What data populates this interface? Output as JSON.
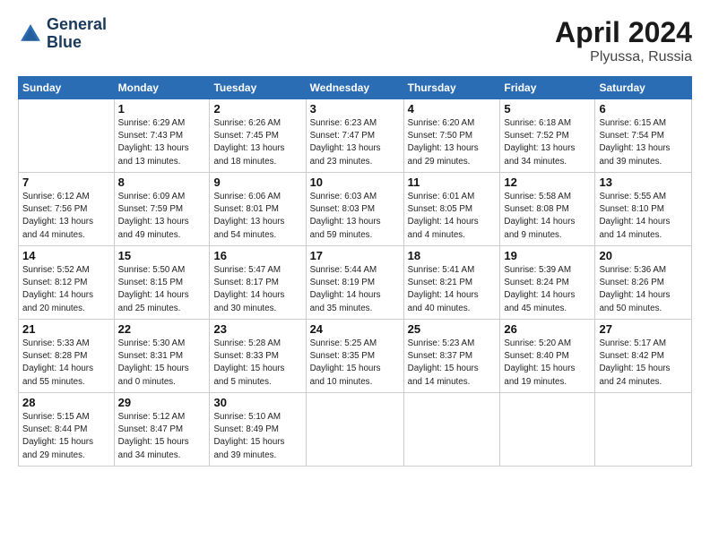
{
  "header": {
    "logo_line1": "General",
    "logo_line2": "Blue",
    "title": "April 2024",
    "subtitle": "Plyussa, Russia"
  },
  "days_of_week": [
    "Sunday",
    "Monday",
    "Tuesday",
    "Wednesday",
    "Thursday",
    "Friday",
    "Saturday"
  ],
  "weeks": [
    [
      {
        "day": "",
        "info": ""
      },
      {
        "day": "1",
        "info": "Sunrise: 6:29 AM\nSunset: 7:43 PM\nDaylight: 13 hours\nand 13 minutes."
      },
      {
        "day": "2",
        "info": "Sunrise: 6:26 AM\nSunset: 7:45 PM\nDaylight: 13 hours\nand 18 minutes."
      },
      {
        "day": "3",
        "info": "Sunrise: 6:23 AM\nSunset: 7:47 PM\nDaylight: 13 hours\nand 23 minutes."
      },
      {
        "day": "4",
        "info": "Sunrise: 6:20 AM\nSunset: 7:50 PM\nDaylight: 13 hours\nand 29 minutes."
      },
      {
        "day": "5",
        "info": "Sunrise: 6:18 AM\nSunset: 7:52 PM\nDaylight: 13 hours\nand 34 minutes."
      },
      {
        "day": "6",
        "info": "Sunrise: 6:15 AM\nSunset: 7:54 PM\nDaylight: 13 hours\nand 39 minutes."
      }
    ],
    [
      {
        "day": "7",
        "info": "Sunrise: 6:12 AM\nSunset: 7:56 PM\nDaylight: 13 hours\nand 44 minutes."
      },
      {
        "day": "8",
        "info": "Sunrise: 6:09 AM\nSunset: 7:59 PM\nDaylight: 13 hours\nand 49 minutes."
      },
      {
        "day": "9",
        "info": "Sunrise: 6:06 AM\nSunset: 8:01 PM\nDaylight: 13 hours\nand 54 minutes."
      },
      {
        "day": "10",
        "info": "Sunrise: 6:03 AM\nSunset: 8:03 PM\nDaylight: 13 hours\nand 59 minutes."
      },
      {
        "day": "11",
        "info": "Sunrise: 6:01 AM\nSunset: 8:05 PM\nDaylight: 14 hours\nand 4 minutes."
      },
      {
        "day": "12",
        "info": "Sunrise: 5:58 AM\nSunset: 8:08 PM\nDaylight: 14 hours\nand 9 minutes."
      },
      {
        "day": "13",
        "info": "Sunrise: 5:55 AM\nSunset: 8:10 PM\nDaylight: 14 hours\nand 14 minutes."
      }
    ],
    [
      {
        "day": "14",
        "info": "Sunrise: 5:52 AM\nSunset: 8:12 PM\nDaylight: 14 hours\nand 20 minutes."
      },
      {
        "day": "15",
        "info": "Sunrise: 5:50 AM\nSunset: 8:15 PM\nDaylight: 14 hours\nand 25 minutes."
      },
      {
        "day": "16",
        "info": "Sunrise: 5:47 AM\nSunset: 8:17 PM\nDaylight: 14 hours\nand 30 minutes."
      },
      {
        "day": "17",
        "info": "Sunrise: 5:44 AM\nSunset: 8:19 PM\nDaylight: 14 hours\nand 35 minutes."
      },
      {
        "day": "18",
        "info": "Sunrise: 5:41 AM\nSunset: 8:21 PM\nDaylight: 14 hours\nand 40 minutes."
      },
      {
        "day": "19",
        "info": "Sunrise: 5:39 AM\nSunset: 8:24 PM\nDaylight: 14 hours\nand 45 minutes."
      },
      {
        "day": "20",
        "info": "Sunrise: 5:36 AM\nSunset: 8:26 PM\nDaylight: 14 hours\nand 50 minutes."
      }
    ],
    [
      {
        "day": "21",
        "info": "Sunrise: 5:33 AM\nSunset: 8:28 PM\nDaylight: 14 hours\nand 55 minutes."
      },
      {
        "day": "22",
        "info": "Sunrise: 5:30 AM\nSunset: 8:31 PM\nDaylight: 15 hours\nand 0 minutes."
      },
      {
        "day": "23",
        "info": "Sunrise: 5:28 AM\nSunset: 8:33 PM\nDaylight: 15 hours\nand 5 minutes."
      },
      {
        "day": "24",
        "info": "Sunrise: 5:25 AM\nSunset: 8:35 PM\nDaylight: 15 hours\nand 10 minutes."
      },
      {
        "day": "25",
        "info": "Sunrise: 5:23 AM\nSunset: 8:37 PM\nDaylight: 15 hours\nand 14 minutes."
      },
      {
        "day": "26",
        "info": "Sunrise: 5:20 AM\nSunset: 8:40 PM\nDaylight: 15 hours\nand 19 minutes."
      },
      {
        "day": "27",
        "info": "Sunrise: 5:17 AM\nSunset: 8:42 PM\nDaylight: 15 hours\nand 24 minutes."
      }
    ],
    [
      {
        "day": "28",
        "info": "Sunrise: 5:15 AM\nSunset: 8:44 PM\nDaylight: 15 hours\nand 29 minutes."
      },
      {
        "day": "29",
        "info": "Sunrise: 5:12 AM\nSunset: 8:47 PM\nDaylight: 15 hours\nand 34 minutes."
      },
      {
        "day": "30",
        "info": "Sunrise: 5:10 AM\nSunset: 8:49 PM\nDaylight: 15 hours\nand 39 minutes."
      },
      {
        "day": "",
        "info": ""
      },
      {
        "day": "",
        "info": ""
      },
      {
        "day": "",
        "info": ""
      },
      {
        "day": "",
        "info": ""
      }
    ]
  ]
}
